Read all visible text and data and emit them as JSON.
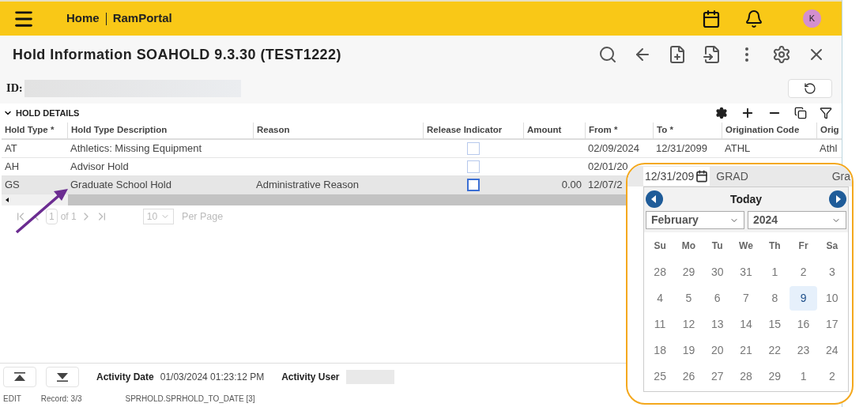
{
  "header": {
    "breadcrumbs": [
      "Home",
      "RamPortal"
    ],
    "avatar": "K"
  },
  "page_title": "Hold Information SOAHOLD 9.3.30 (TEST1222)",
  "id_label": "ID:",
  "section": {
    "title": "HOLD DETAILS",
    "expanded": true
  },
  "table": {
    "columns": [
      "Hold Type *",
      "Hold Type Description",
      "Reason",
      "Release Indicator",
      "Amount",
      "From *",
      "To *",
      "Origination Code",
      "Orig"
    ],
    "rows": [
      {
        "hold_type": "AT",
        "description": "Athletics: Missing Equipment",
        "release_indicator": false,
        "from": "02/09/2024",
        "to": "12/31/2099",
        "origination_code": "ATHL",
        "orig": "Athl",
        "selected": false
      },
      {
        "hold_type": "AH",
        "description": "Advisor Hold",
        "release_indicator": false,
        "from": "02/01/20",
        "selected": false
      },
      {
        "hold_type": "GS",
        "description": "Graduate School Hold",
        "reason": "Administrative Reason",
        "release_indicator": false,
        "amount": "0.00",
        "from": "12/07/2",
        "selected": true
      }
    ]
  },
  "pager": {
    "page": "1",
    "of": "of 1",
    "per_page": "10",
    "per_page_label": "Per Page"
  },
  "footer": {
    "activity_date_label": "Activity Date",
    "activity_date": "01/03/2024 01:23:12 PM",
    "activity_user_label": "Activity User"
  },
  "status_bar": [
    "EDIT",
    "Record: 3/3",
    "SPRHOLD.SPRHOLD_TO_DATE [3]"
  ],
  "popup": {
    "date_value": "12/31/209",
    "code": "GRAD",
    "description": "Gra",
    "calendar": {
      "title": "Today",
      "month": "February",
      "year": "2024",
      "weekdays": [
        "Su",
        "Mo",
        "Tu",
        "We",
        "Th",
        "Fr",
        "Sa"
      ],
      "days": [
        {
          "label": "28",
          "selected": false
        },
        {
          "label": "29",
          "selected": false
        },
        {
          "label": "30",
          "selected": false
        },
        {
          "label": "31",
          "selected": false
        },
        {
          "label": "1",
          "selected": false
        },
        {
          "label": "2",
          "selected": false
        },
        {
          "label": "3",
          "selected": false
        },
        {
          "label": "4",
          "selected": false
        },
        {
          "label": "5",
          "selected": false
        },
        {
          "label": "6",
          "selected": false
        },
        {
          "label": "7",
          "selected": false
        },
        {
          "label": "8",
          "selected": false
        },
        {
          "label": "9",
          "selected": true
        },
        {
          "label": "10",
          "selected": false
        },
        {
          "label": "11",
          "selected": false
        },
        {
          "label": "12",
          "selected": false
        },
        {
          "label": "13",
          "selected": false
        },
        {
          "label": "14",
          "selected": false
        },
        {
          "label": "15",
          "selected": false
        },
        {
          "label": "16",
          "selected": false
        },
        {
          "label": "17",
          "selected": false
        },
        {
          "label": "18",
          "selected": false
        },
        {
          "label": "19",
          "selected": false
        },
        {
          "label": "20",
          "selected": false
        },
        {
          "label": "21",
          "selected": false
        },
        {
          "label": "22",
          "selected": false
        },
        {
          "label": "23",
          "selected": false
        },
        {
          "label": "24",
          "selected": false
        },
        {
          "label": "25",
          "selected": false
        },
        {
          "label": "26",
          "selected": false
        },
        {
          "label": "27",
          "selected": false
        },
        {
          "label": "28",
          "selected": false
        },
        {
          "label": "29",
          "selected": false
        },
        {
          "label": "1",
          "selected": false
        },
        {
          "label": "2",
          "selected": false
        }
      ]
    }
  }
}
